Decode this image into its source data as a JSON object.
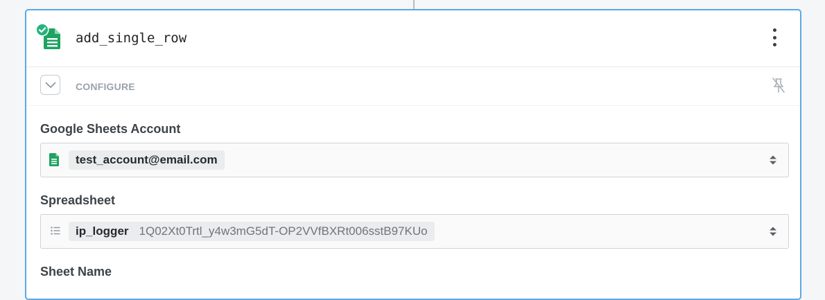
{
  "step": {
    "title": "add_single_row",
    "status": "success",
    "app_icon": "google-sheets-icon"
  },
  "configure": {
    "label": "CONFIGURE",
    "toggle_icon": "chevron-down-icon",
    "pin_icon": "unpin-icon"
  },
  "fields": {
    "account": {
      "label": "Google Sheets Account",
      "value": "test_account@email.com",
      "icon": "google-sheets-icon"
    },
    "spreadsheet": {
      "label": "Spreadsheet",
      "value": "ip_logger",
      "id": "1Q02Xt0Trtl_y4w3mG5dT-OP2VVfBXRt006sstB97KUo",
      "icon": "list-icon"
    },
    "sheet_name": {
      "label": "Sheet Name"
    }
  },
  "colors": {
    "accent_border": "#5aa8e6",
    "sheets_green": "#1ea362",
    "success_green": "#24b47e"
  }
}
